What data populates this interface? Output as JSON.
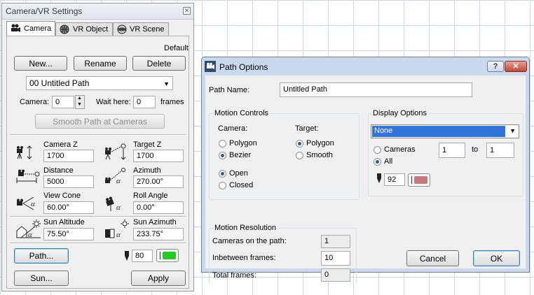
{
  "camera_panel": {
    "title": "Camera/VR Settings",
    "tabs": [
      "Camera",
      "VR Object",
      "VR Scene"
    ],
    "default_label": "Default",
    "new_button": "New...",
    "rename_button": "Rename",
    "delete_button": "Delete",
    "path_select": "00  Untitled Path",
    "camera_label": "Camera:",
    "camera_value": "0",
    "wait_here_label": "Wait here:",
    "wait_here_value": "0",
    "frames_label": "frames",
    "smooth_button": "Smooth Path at Cameras",
    "params": {
      "camera_z": {
        "label": "Camera Z",
        "value": "1700"
      },
      "target_z": {
        "label": "Target Z",
        "value": "1700"
      },
      "distance": {
        "label": "Distance",
        "value": "5000"
      },
      "azimuth": {
        "label": "Azimuth",
        "value": "270.00°"
      },
      "view_cone": {
        "label": "View Cone",
        "value": "60.00°"
      },
      "roll_angle": {
        "label": "Roll Angle",
        "value": "0.00°"
      },
      "sun_altitude": {
        "label": "Sun Altitude",
        "value": "75.50°"
      },
      "sun_azimuth": {
        "label": "Sun Azimuth",
        "value": "233.75°"
      }
    },
    "path_button": "Path...",
    "pen_value": "80",
    "sun_button": "Sun...",
    "apply_button": "Apply",
    "pen_color": "#22cc22"
  },
  "path_dialog": {
    "title": "Path Options",
    "path_name_label": "Path Name:",
    "path_name_value": "Untitled Path",
    "motion_controls": {
      "title": "Motion Controls",
      "camera_label": "Camera:",
      "target_label": "Target:",
      "camera_options": [
        "Polygon",
        "Bezier"
      ],
      "camera_selected": "Bezier",
      "target_options": [
        "Polygon",
        "Smooth"
      ],
      "target_selected": "Polygon",
      "open_label": "Open",
      "closed_label": "Closed",
      "open_closed_selected": "Open"
    },
    "display_options": {
      "title": "Display Options",
      "select_value": "None",
      "cameras_label": "Cameras",
      "all_label": "All",
      "selected": "All",
      "from_value": "1",
      "to_label": "to",
      "to_value": "1",
      "pen_value": "92",
      "pen_color": "#c97878"
    },
    "motion_resolution": {
      "title": "Motion Resolution",
      "cameras_on_path_label": "Cameras on the path:",
      "cameras_on_path_value": "1",
      "inbetween_label": "Inbetween frames:",
      "inbetween_value": "10",
      "total_label": "Total frames:",
      "total_value": "0"
    },
    "cancel_button": "Cancel",
    "ok_button": "OK",
    "accent_select": "#3174dc"
  }
}
